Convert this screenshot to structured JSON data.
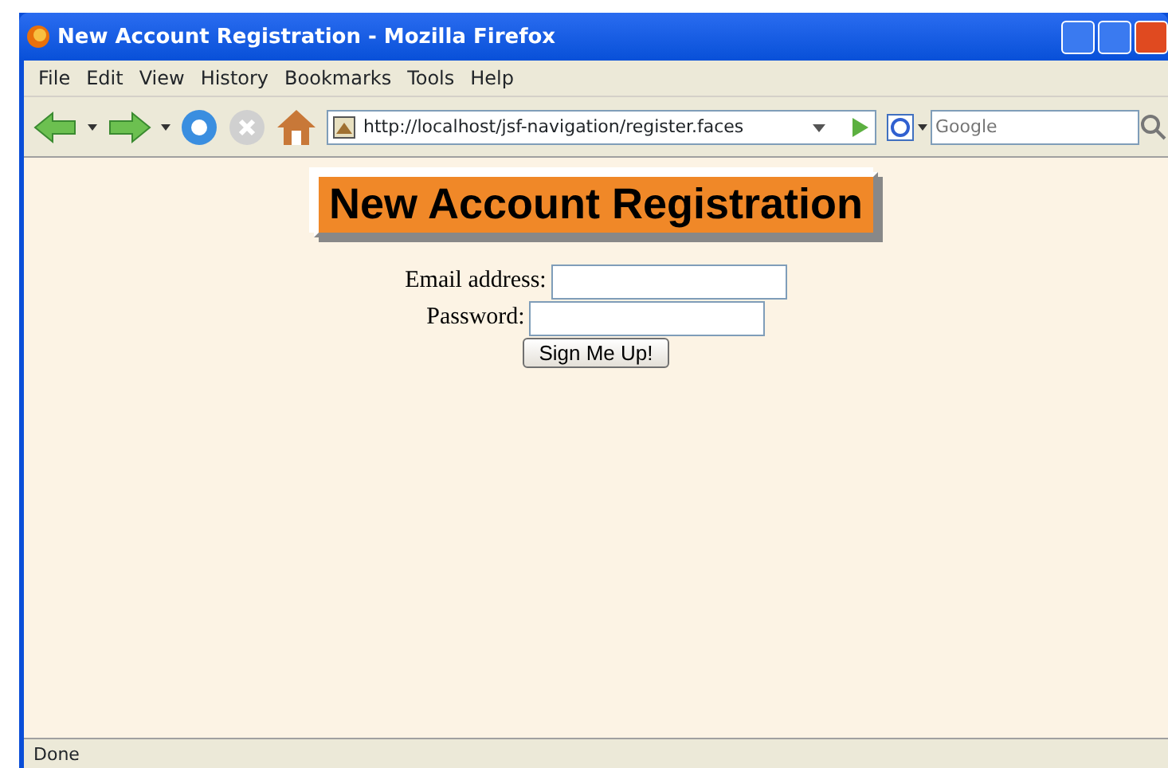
{
  "window": {
    "title": "New Account Registration - Mozilla Firefox"
  },
  "menu": [
    "File",
    "Edit",
    "View",
    "History",
    "Bookmarks",
    "Tools",
    "Help"
  ],
  "toolbar": {
    "url": "http://localhost/jsf-navigation/register.faces",
    "search": {
      "placeholder": "Google"
    }
  },
  "page": {
    "heading": "New Account Registration",
    "fields": [
      {
        "label": "Email address:"
      },
      {
        "label": "Password:"
      }
    ],
    "button": "Sign Me Up!"
  },
  "status_bar": "Done"
}
